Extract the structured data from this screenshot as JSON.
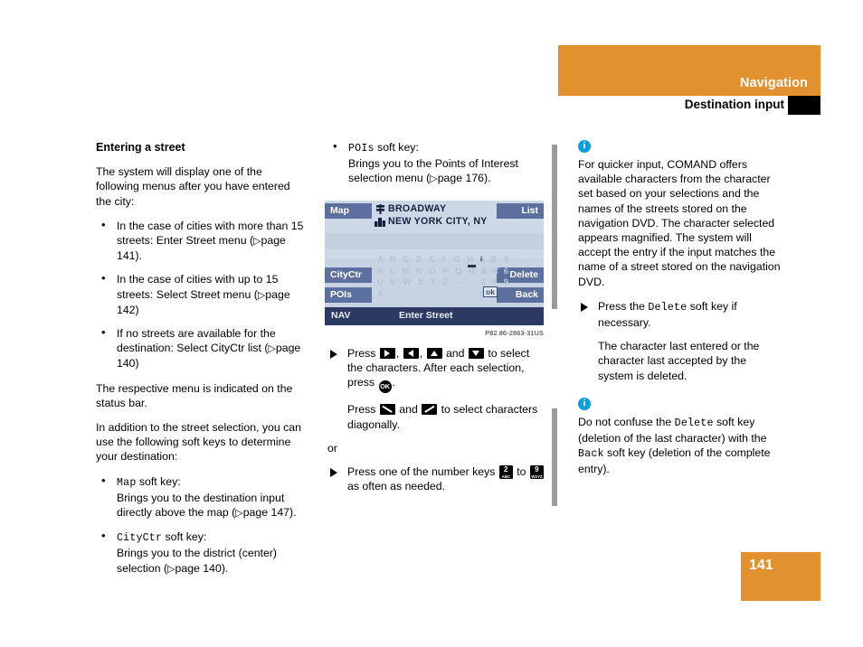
{
  "header": {
    "chapter": "Navigation",
    "section": "Destination input",
    "accent_color": "#e2912f"
  },
  "col1": {
    "title": "Entering a street",
    "intro": "The system will display one of the following menus after you have entered the city:",
    "bullets": [
      {
        "text_a": "In the case of cities with more than 15 streets: Enter Street menu (",
        "ref": "page 141",
        "text_b": ")."
      },
      {
        "text_a": "In the case of cities with up to 15 streets: Select Street menu (",
        "ref": "page 142",
        "text_b": ")"
      },
      {
        "text_a": "If no streets are available for the destination: Select CityCtr list (",
        "ref": "page 140",
        "text_b": ")"
      }
    ],
    "para_status": "The respective menu is indicated on the status bar.",
    "para_softkeys": "In addition to the street selection, you can use the following soft keys to determine your destination:",
    "softkey_bullets": [
      {
        "key": "Map",
        "label": " soft key:",
        "desc_a": "Brings you to the destination input directly above the map (",
        "ref": "page 147",
        "desc_b": ")."
      },
      {
        "key": "CityCtr",
        "label": " soft key:",
        "desc_a": "Brings you to the district (center) selection (",
        "ref": "page 140",
        "desc_b": ")."
      }
    ]
  },
  "col2": {
    "softkey_bullet": {
      "key": "POIs",
      "label": " soft key:",
      "desc_a": "Brings you to the Points of Interest selection menu (",
      "ref": "page 176",
      "desc_b": ")."
    },
    "figure": {
      "caption": "P82.86-2863-31US",
      "soft_keys": {
        "map": "Map",
        "cityctr": "CityCtr",
        "pois": "POIs",
        "list": "List",
        "delete": "Delete",
        "back": "Back"
      },
      "entry_street": "BROADWAY",
      "entry_city": "NEW YORK CITY, NY",
      "street_icon": "street-sign-icon",
      "city_icon": "city-buildings-icon",
      "charmap_rows": [
        "A B C D E F G H I J",
        "K L M N O P Q R S T",
        "U V W X Y Z - ` . ,",
        "&"
      ],
      "charmap_numbers": [
        "1 2 3",
        "4 5 6",
        "7 8 9",
        "0"
      ],
      "highlighted_char": "I",
      "ok_label": "ok",
      "status_mode": "NAV",
      "status_title": "Enter Street",
      "screen_bg": "#c8d4e3",
      "softkey_bg": "#5c6f9e",
      "statusbar_bg": "#2c3a63"
    },
    "step1_a": "Press ",
    "step1_b": ", ",
    "step1_c": ", ",
    "step1_d": " and ",
    "step1_e": " to select the characters. After each selection, press ",
    "step1_f": ".",
    "ok_key_label": "OK",
    "step2_a": "Press ",
    "step2_b": " and ",
    "step2_c": " to select characters diagonally.",
    "or_label": "or",
    "step3_a": "Press one of the number keys ",
    "step3_b": " to ",
    "step3_c": " as often as needed.",
    "numkey2": {
      "digit": "2",
      "letters": "ABC"
    },
    "numkey9": {
      "digit": "9",
      "letters": "WXYZ"
    }
  },
  "col3": {
    "note1_text": "For quicker input, COMAND offers available characters from the character set based on your selections and the names of the streets stored on the navigation DVD. The character selected appears magnified. The system will accept the entry if the input matches the name of a street stored on the navigation DVD.",
    "step_a": "Press the ",
    "step_key": "Delete",
    "step_b": " soft key if necessary.",
    "step_cont": "The character last entered or the character last accepted by the system is deleted.",
    "note2_a": "Do not confuse the ",
    "note2_key1": "Delete",
    "note2_b": " soft key (deletion of the last character) with the ",
    "note2_key2": "Back",
    "note2_c": " soft key (deletion of the complete entry).",
    "info_badge": "i",
    "info_color": "#0d9ddb",
    "bar_color": "#9a9a9a"
  },
  "footer": {
    "page_number": "141"
  }
}
